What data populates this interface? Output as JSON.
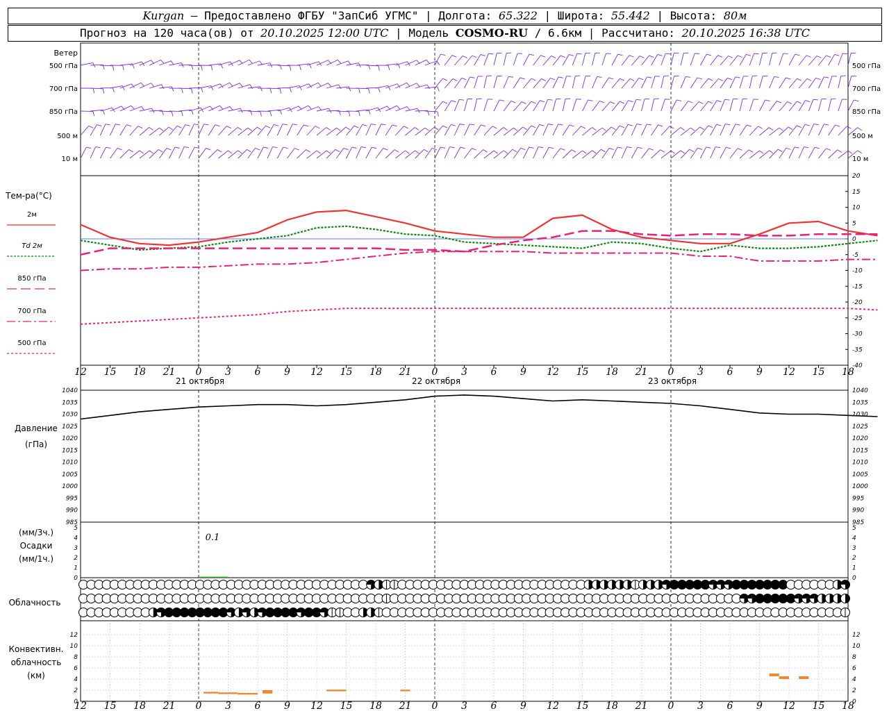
{
  "header": {
    "city": "Kurgan",
    "provider": " — Предоставлено ФГБУ \"ЗапСиб УГМС\" | Долгота: ",
    "lon": "65.322",
    "lat_label": " | Широта: ",
    "lat": "55.442",
    "alt_label": " | Высота: ",
    "alt": "80м",
    "forecast_label": "Прогноз на 120 часа(ов) от ",
    "forecast_time": "20.10.2025 12:00 UTC",
    "model_label": " | Модель ",
    "model": "COSMO-RU",
    "model_res": " / 6.6км",
    "calc_label": " | Рассчитано: ",
    "calc_time": "20.10.2025 16:38 UTC"
  },
  "colors": {
    "t2m": "#ee3333",
    "td2m": "#118811",
    "upper": "#e8207a",
    "wind": "#7a2ee6",
    "pressure": "#000000",
    "precip": "#22aa22",
    "convective": "#ee8833",
    "grid": "#000000",
    "zero_line": "#3355ff"
  },
  "chart_data": {
    "type": "line",
    "x": {
      "tick_labels": [
        "12",
        "15",
        "18",
        "21",
        "0",
        "3",
        "6",
        "9",
        "12",
        "15",
        "18",
        "21",
        "0",
        "3",
        "6",
        "9",
        "12",
        "15",
        "18",
        "21",
        "0",
        "3",
        "6",
        "9",
        "12",
        "15",
        "18"
      ],
      "day_labels": [
        {
          "label": "21 октября",
          "at": "12"
        },
        {
          "label": "22 октября",
          "at": "12"
        },
        {
          "label": "23 октября",
          "at": "12"
        }
      ],
      "hours_start": 0,
      "hours_end": 78,
      "step": 3
    },
    "wind": {
      "title": "Ветер",
      "levels": [
        "500 гПа",
        "700 гПа",
        "850 гПа",
        "500 м",
        "10  м"
      ]
    },
    "temperature": {
      "title": "Тем-ра(°C)",
      "ylim": [
        -40,
        20
      ],
      "yticks": [
        20,
        15,
        10,
        5,
        0,
        -5,
        -10,
        -15,
        -20,
        -25,
        -30,
        -35,
        -40
      ],
      "series": [
        {
          "name": "2м",
          "values": [
            4.5,
            0.5,
            -1.5,
            -2,
            -1,
            0.5,
            2,
            6,
            8.5,
            9,
            7,
            5,
            2.5,
            1.5,
            0.5,
            0.5,
            6.5,
            7.5,
            3,
            0.5,
            -0.5,
            -1.5,
            -1.5,
            1.5,
            5,
            5.5,
            2.5,
            1
          ]
        },
        {
          "name": "Td 2м",
          "values": [
            -0.5,
            -2,
            -3.5,
            -3,
            -2.5,
            -1,
            0,
            1,
            3.5,
            4,
            3,
            1.5,
            1,
            -1,
            -1.5,
            -2,
            -2.5,
            -3,
            -1,
            -1.5,
            -3,
            -4,
            -2,
            -3,
            -3,
            -2.5,
            -1.5,
            -0.5
          ]
        },
        {
          "name": "850 гПа",
          "values": [
            -5,
            -3,
            -3,
            -3,
            -3,
            -3,
            -3,
            -3,
            -3,
            -3,
            -3,
            -3.5,
            -3.5,
            -4,
            -2,
            -0.5,
            0.5,
            2.5,
            2.5,
            1.5,
            1,
            1.5,
            1.5,
            1,
            1,
            1.5,
            1.5,
            1.5
          ]
        },
        {
          "name": "700 гПа",
          "values": [
            -10,
            -9.5,
            -9.5,
            -9,
            -9,
            -8.5,
            -8,
            -8,
            -7.5,
            -6.5,
            -5.5,
            -4.5,
            -4,
            -4,
            -4,
            -4,
            -4.5,
            -4.5,
            -4.5,
            -4.5,
            -4.5,
            -5.5,
            -5.5,
            -7,
            -7,
            -7,
            -6.5,
            -6.5
          ]
        },
        {
          "name": "500 гПа",
          "values": [
            -27,
            -26.5,
            -26,
            -25.5,
            -25,
            -24.5,
            -24,
            -23,
            -22.5,
            -22,
            -22,
            -22,
            -22,
            -22,
            -22,
            -22,
            -22,
            -22,
            -22,
            -22,
            -22,
            -22,
            -22,
            -22,
            -22,
            -22,
            -22,
            -22.5
          ]
        }
      ]
    },
    "pressure": {
      "title": "Давление",
      "unit": "(гПа)",
      "ylim": [
        985,
        1040
      ],
      "yticks": [
        1040,
        1035,
        1030,
        1025,
        1020,
        1015,
        1010,
        1005,
        1000,
        995,
        990,
        985
      ],
      "values": [
        1028,
        1029.5,
        1031,
        1032,
        1033,
        1033.5,
        1034,
        1034,
        1033.5,
        1034,
        1035,
        1036,
        1037.5,
        1038,
        1037.5,
        1036.5,
        1035.5,
        1036,
        1035.5,
        1035,
        1034.5,
        1033.5,
        1032,
        1030.5,
        1030,
        1030,
        1029.5,
        1029
      ]
    },
    "precip": {
      "title": "Осадки",
      "unit_top": "(мм/3ч.)",
      "unit_bottom": "(мм/1ч.)",
      "ylim": [
        0,
        5
      ],
      "yticks": [
        5,
        4,
        3,
        2,
        1,
        0
      ],
      "annotation": "0.1",
      "annotation_at_hour": 12,
      "values": [
        0,
        0,
        0,
        0,
        0.1,
        0,
        0,
        0,
        0,
        0,
        0,
        0,
        0,
        0,
        0,
        0,
        0,
        0,
        0,
        0,
        0,
        0,
        0,
        0,
        0,
        0,
        0,
        0
      ]
    },
    "cloud": {
      "title": "Облачность",
      "rows": [
        [
          0,
          0,
          0,
          0,
          0,
          0,
          0,
          0,
          0,
          0,
          0,
          0,
          0,
          0,
          0,
          0,
          0,
          0,
          0,
          0,
          0,
          0,
          0,
          0,
          0,
          0,
          0,
          0,
          0,
          0,
          0,
          0,
          0,
          0,
          0,
          0,
          0,
          3,
          2,
          1,
          1,
          0,
          0,
          0,
          0,
          0,
          0,
          0,
          0,
          0,
          0,
          0,
          0,
          0,
          0,
          0,
          0,
          0,
          0,
          0,
          0,
          0,
          0,
          0,
          0,
          2,
          2,
          2,
          2,
          2,
          2,
          1,
          2,
          2,
          2,
          3,
          4,
          4,
          4,
          4,
          4,
          3,
          3,
          3,
          4,
          4,
          4,
          4,
          4,
          4,
          4,
          0,
          0,
          0,
          0,
          0,
          0,
          2,
          3
        ],
        [
          0,
          0,
          0,
          0,
          0,
          0,
          0,
          0,
          0,
          0,
          0,
          0,
          0,
          0,
          0,
          0,
          0,
          0,
          0,
          0,
          0,
          0,
          0,
          0,
          0,
          0,
          0,
          0,
          0,
          0,
          0,
          0,
          0,
          0,
          0,
          0,
          0,
          0,
          0,
          1,
          0,
          0,
          0,
          0,
          0,
          0,
          0,
          0,
          0,
          0,
          0,
          0,
          0,
          0,
          0,
          0,
          0,
          0,
          0,
          0,
          0,
          0,
          0,
          0,
          0,
          0,
          0,
          0,
          0,
          0,
          0,
          0,
          0,
          0,
          0,
          0,
          0,
          0,
          0,
          0,
          0,
          0,
          0,
          0,
          0,
          3,
          3,
          4,
          4,
          4,
          4,
          4,
          3,
          3,
          3,
          2,
          2,
          2,
          2
        ],
        [
          0,
          0,
          0,
          0,
          0,
          0,
          0,
          0,
          0,
          2,
          3,
          4,
          4,
          4,
          4,
          4,
          4,
          4,
          4,
          3,
          2,
          3,
          2,
          3,
          4,
          4,
          4,
          4,
          3,
          4,
          4,
          3,
          1,
          1,
          0,
          0,
          2,
          2,
          1,
          0,
          0,
          0,
          0,
          0,
          0,
          0,
          0,
          0,
          0,
          0,
          0,
          0,
          0,
          0,
          0,
          0,
          0,
          0,
          0,
          0,
          0,
          0,
          0,
          0,
          0,
          0,
          0,
          0,
          0,
          0,
          0,
          0,
          0,
          0,
          0,
          0,
          0,
          0,
          0,
          0,
          0,
          0,
          0,
          0,
          0,
          0,
          0,
          0,
          0,
          0,
          0,
          0,
          0,
          0,
          0,
          0,
          0,
          0,
          1
        ]
      ]
    },
    "convective": {
      "title_line1": "Конвективн.",
      "title_line2": "облачность",
      "unit": "(км)",
      "ylim": [
        0,
        14
      ],
      "yticks": [
        12,
        10,
        8,
        6,
        4,
        2,
        0
      ],
      "segments": [
        {
          "start_hour": 12.5,
          "end_hour": 14,
          "base_km": 1.4,
          "top_km": 1.7
        },
        {
          "start_hour": 14,
          "end_hour": 16,
          "base_km": 1.3,
          "top_km": 1.6
        },
        {
          "start_hour": 16,
          "end_hour": 18,
          "base_km": 1.2,
          "top_km": 1.5
        },
        {
          "start_hour": 18.5,
          "end_hour": 19.5,
          "base_km": 1.4,
          "top_km": 2.0
        },
        {
          "start_hour": 25,
          "end_hour": 27,
          "base_km": 1.8,
          "top_km": 2.1
        },
        {
          "start_hour": 32.5,
          "end_hour": 33.5,
          "base_km": 1.8,
          "top_km": 2.1
        },
        {
          "start_hour": 70,
          "end_hour": 71,
          "base_km": 4.5,
          "top_km": 5.0
        },
        {
          "start_hour": 71,
          "end_hour": 72,
          "base_km": 4.0,
          "top_km": 4.5
        },
        {
          "start_hour": 73,
          "end_hour": 74,
          "base_km": 4.0,
          "top_km": 4.5
        }
      ]
    }
  }
}
